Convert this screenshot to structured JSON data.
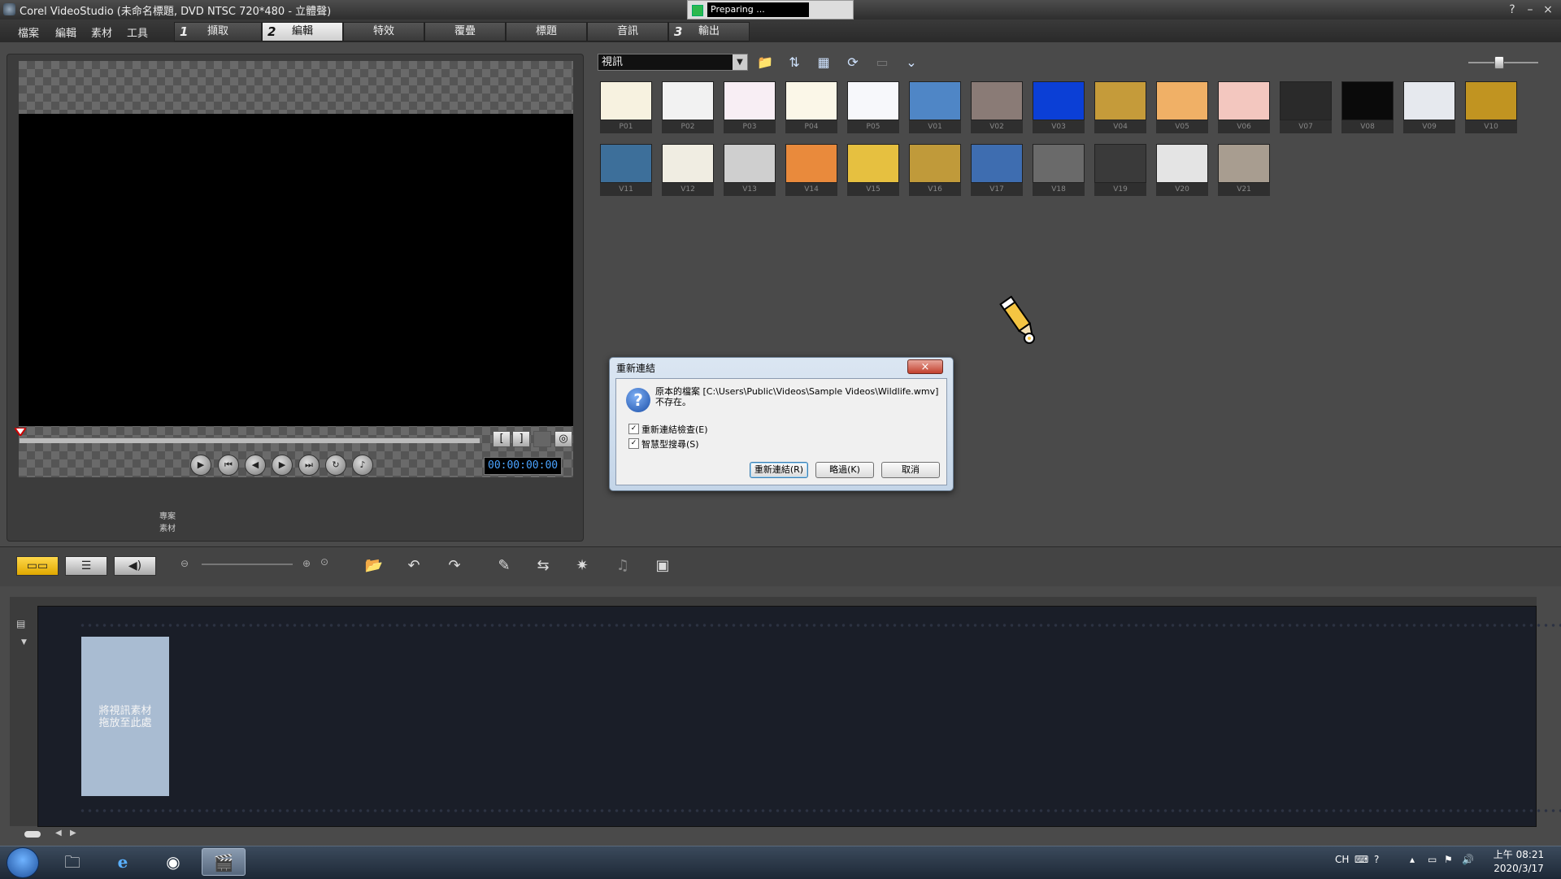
{
  "window": {
    "title": "Corel VideoStudio (未命名標題, DVD NTSC 720*480 - 立體聲)",
    "progress_text": "Preparing ...",
    "help_label": "?",
    "minimize_label": "–",
    "close_label": "×"
  },
  "menu": [
    "檔案",
    "編輯",
    "素材",
    "工具"
  ],
  "steps": [
    {
      "num": "1",
      "label": "擷取",
      "active": false
    },
    {
      "num": "2",
      "label": "編輯",
      "active": true
    },
    {
      "num": "",
      "label": "特效",
      "active": false
    },
    {
      "num": "",
      "label": "覆疊",
      "active": false
    },
    {
      "num": "",
      "label": "標題",
      "active": false
    },
    {
      "num": "",
      "label": "音訊",
      "active": false
    },
    {
      "num": "3",
      "label": "輸出",
      "active": false
    }
  ],
  "preview": {
    "mode_project": "專案",
    "mode_clip": "素材",
    "timecode": "00:00:00:00",
    "mark_in": "[",
    "mark_out": "]"
  },
  "library": {
    "category": "視訊",
    "items": [
      "P01",
      "P02",
      "P03",
      "P04",
      "P05",
      "V01",
      "V02",
      "V03",
      "V04",
      "V05",
      "V06",
      "V07",
      "V08",
      "V09",
      "V10",
      "V11",
      "V12",
      "V13",
      "V14",
      "V15",
      "V16",
      "V17",
      "V18",
      "V19",
      "V20",
      "V21"
    ],
    "thumb_colors": [
      "#f7f2e0",
      "#f2f2f2",
      "#f8eef4",
      "#fbf7e8",
      "#f7f8fb",
      "#4f86c6",
      "#8a7b76",
      "#0b3fd6",
      "#c59b3a",
      "#f0b066",
      "#f3c7bf",
      "#2a2a2a",
      "#0a0a0a",
      "#e6e9ee",
      "#c19421",
      "#3d6f9a",
      "#f0ede2",
      "#cfcfcf",
      "#e98a3c",
      "#e6c040",
      "#c09a3a",
      "#3e6db0",
      "#6a6a6a",
      "#3a3a3a",
      "#e4e4e4",
      "#a89d90"
    ]
  },
  "dialog": {
    "title": "重新連結",
    "close": "×",
    "question_icon": "?",
    "message": "原本的檔案 [C:\\Users\\Public\\Videos\\Sample Videos\\Wildlife.wmv] 不存在。",
    "check1": "重新連結檢查(E)",
    "check2": "智慧型搜尋(S)",
    "btn_relink": "重新連結(R)",
    "btn_skip": "略過(K)",
    "btn_cancel": "取消"
  },
  "timeline": {
    "drop_hint_line1": "將視訊素材",
    "drop_hint_line2": "拖放至此處"
  },
  "taskbar": {
    "lang": "CH",
    "time": "上午 08:21",
    "date": "2020/3/17"
  }
}
